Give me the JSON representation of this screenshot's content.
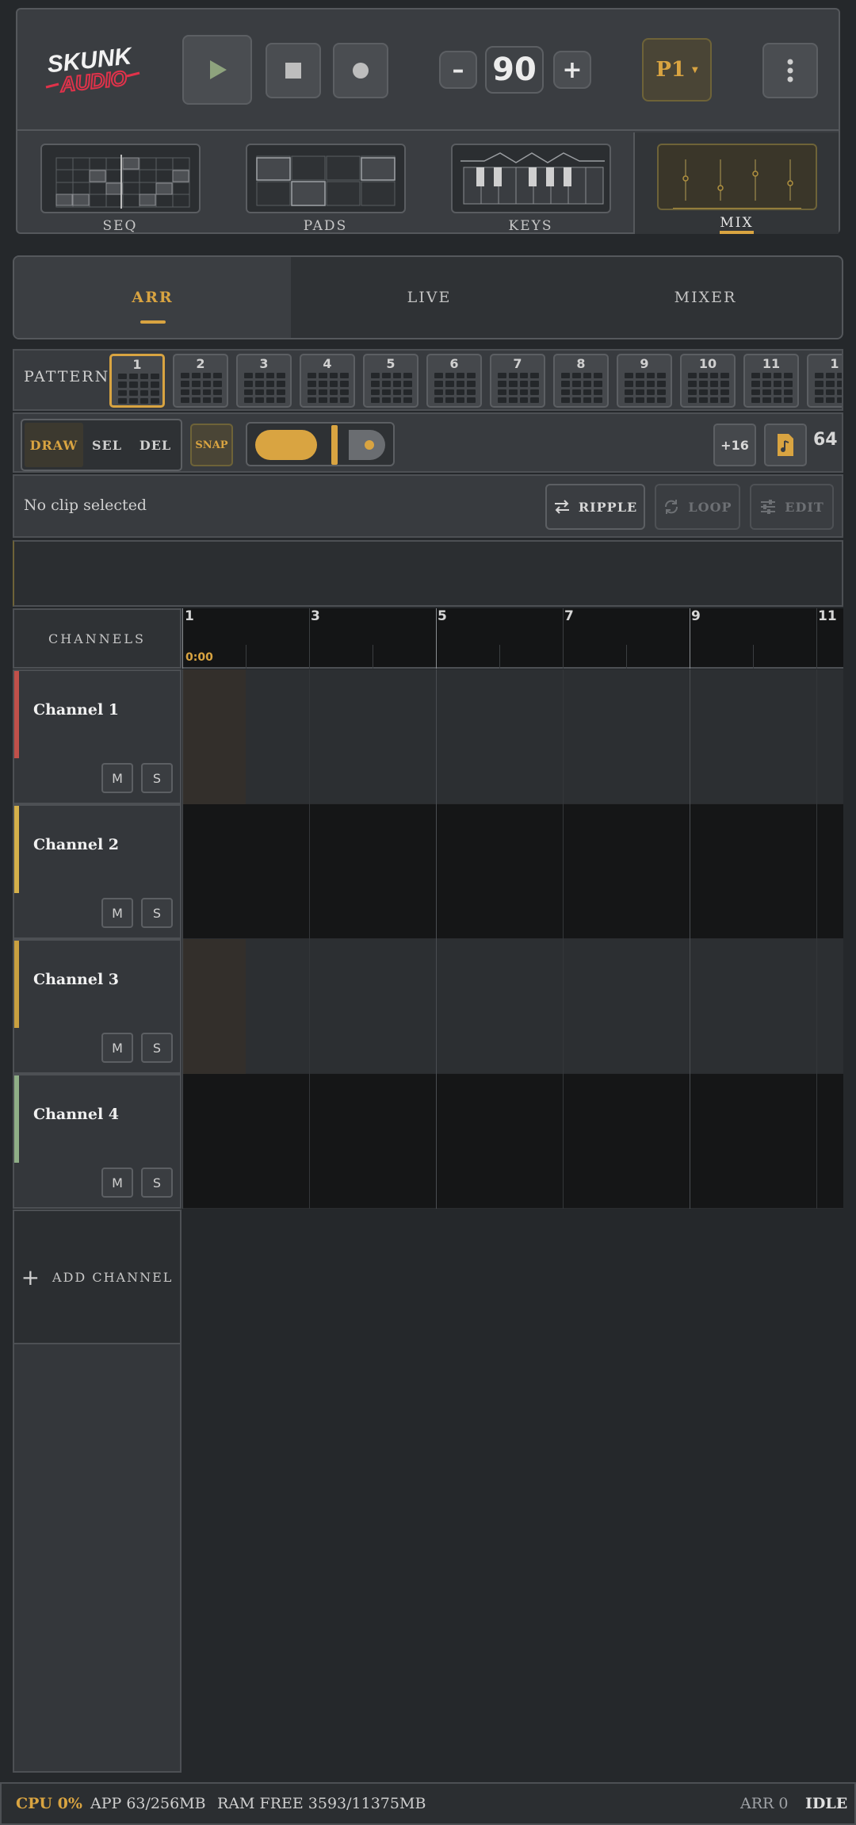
{
  "brand": {
    "line1": "SKUNK",
    "line2": "AUDIO"
  },
  "transport": {
    "bpm": "90",
    "minus": "–",
    "plus": "+",
    "pattern_select": "P1"
  },
  "modes": [
    {
      "label": "SEQ"
    },
    {
      "label": "PADS"
    },
    {
      "label": "KEYS"
    },
    {
      "label": "MIX"
    }
  ],
  "view_tabs": [
    "ARR",
    "LIVE",
    "MIXER"
  ],
  "pattern_bar": {
    "label": "PATTERN",
    "patterns": [
      "1",
      "2",
      "3",
      "4",
      "5",
      "6",
      "7",
      "8",
      "9",
      "10",
      "11",
      "1"
    ]
  },
  "tools": {
    "draw": "DRAW",
    "sel": "SEL",
    "del": "DEL",
    "snap": "SNAP",
    "add16": "+16",
    "length": "64"
  },
  "clip_bar": {
    "status": "No clip selected",
    "ripple": "RIPPLE",
    "loop": "LOOP",
    "edit": "EDIT"
  },
  "timeline": {
    "header": "CHANNELS",
    "bars": [
      "1",
      "3",
      "5",
      "7",
      "9",
      "11"
    ],
    "time": "0:00"
  },
  "channels": [
    {
      "name": "Channel 1",
      "color": "#c0504a",
      "mute": "M",
      "solo": "S"
    },
    {
      "name": "Channel 2",
      "color": "#d4b04a",
      "mute": "M",
      "solo": "S"
    },
    {
      "name": "Channel 3",
      "color": "#c9a040",
      "mute": "M",
      "solo": "S"
    },
    {
      "name": "Channel 4",
      "color": "#8fae86",
      "mute": "M",
      "solo": "S"
    }
  ],
  "add_channel": "ADD CHANNEL",
  "status": {
    "cpu": "CPU 0%",
    "app": "APP 63/256MB",
    "ram": "RAM FREE 3593/11375MB",
    "arr": "ARR 0",
    "state": "IDLE"
  },
  "colors": {
    "accent": "#d9a441",
    "bg": "#25282b",
    "panel": "#383b3f"
  }
}
